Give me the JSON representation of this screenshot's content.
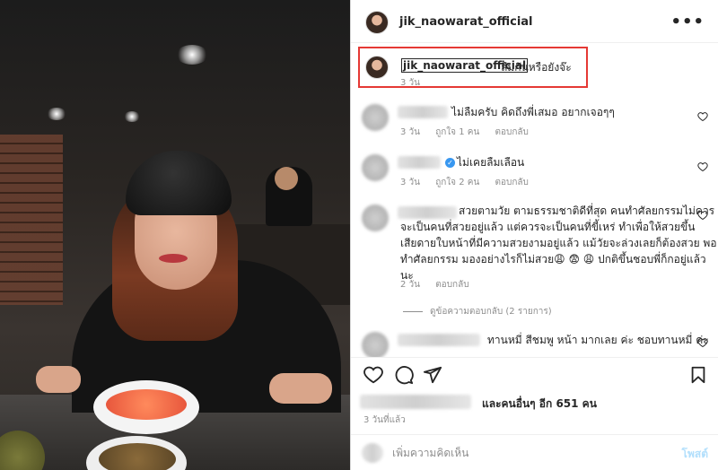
{
  "post": {
    "username": "jik_naowarat_official",
    "more_label": "•••"
  },
  "caption": {
    "username": "jik_naowarat_official",
    "text": "ลืมกันหรือยังจ๊ะ",
    "time": "3 วัน"
  },
  "comments": [
    {
      "text": "ไม่ลืมครับ คิดถึงพี่เสมอ อยากเจอๆๆ",
      "time": "3 วัน",
      "likes": "ถูกใจ 1 คน",
      "reply": "ตอบกลับ"
    },
    {
      "text": "ไม่เคยลืมเลือน",
      "time": "3 วัน",
      "likes": "ถูกใจ 2 คน",
      "reply": "ตอบกลับ",
      "verified": true
    },
    {
      "text_line1": "สวยตามวัย ตามธรรมชาติดีที่สุด คนทำศัลยกรรมไม่ควร",
      "text_line2": "จะเป็นคนที่สวยอยู่แล้ว แต่ควรจะเป็นคนที่ขี้เหร่ ทำเพื่อให้สวยขึ้น",
      "text_line3": "เสียดายใบหน้าที่มีความสวยงามอยู่แล้ว แม้วัยจะล่วงเลยก็ต้องสวย พอ",
      "text_line4": "ทำศัลยกรรม มองอย่างไรก็ไม่สวย😩 😨 😩 ปกติขึ้นชอบพี่ก็กอยู่แล้ว",
      "text_line5": "นะ",
      "time": "2 วัน",
      "reply": "ตอบกลับ",
      "view_replies": "ดูข้อความตอบกลับ (2 รายการ)"
    },
    {
      "text": "ทานหมี่ สีชมพู หน้า มากเลย ค่ะ ชอบทานหมี่ ค่ะ"
    }
  ],
  "actions": {
    "like_icon": "heart-outline-icon",
    "comment_icon": "comment-bubble-icon",
    "share_icon": "paper-plane-icon",
    "save_icon": "bookmark-icon"
  },
  "likes_summary": "และคนอื่นๆ อีก 651 คน",
  "post_time": "3 วันที่แล้ว",
  "add_comment": {
    "placeholder": "เพิ่มความคิดเห็น",
    "post_label": "โพสต์"
  },
  "colors": {
    "highlight": "#e53935",
    "verified": "#3897f0",
    "post_button": "#b2dffc",
    "muted": "#8e8e8e"
  }
}
